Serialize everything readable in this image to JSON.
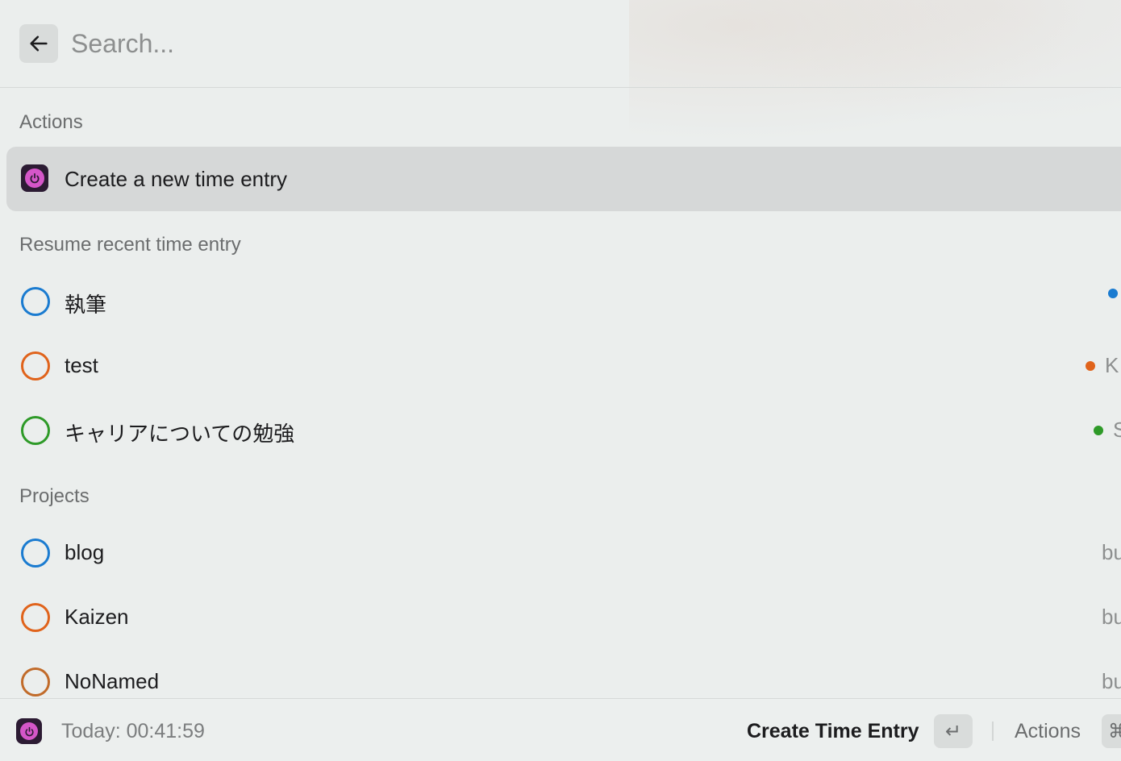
{
  "search": {
    "placeholder": "Search..."
  },
  "sections": {
    "actions_title": "Actions",
    "resume_title": "Resume recent time entry",
    "projects_title": "Projects"
  },
  "actions": [
    {
      "label": "Create a new time entry",
      "icon": "toggl-app-icon"
    }
  ],
  "recent_entries": [
    {
      "label": "執筆",
      "color": "#1a7bd0",
      "accessory": ""
    },
    {
      "label": "test",
      "color": "#e0631b",
      "accessory": "K"
    },
    {
      "label": "キャリアについての勉強",
      "color": "#2e9a28",
      "accessory": "S"
    }
  ],
  "projects": [
    {
      "label": "blog",
      "color": "#1a7bd0",
      "accessory": "bu"
    },
    {
      "label": "Kaizen",
      "color": "#e0631b",
      "accessory": "bu"
    },
    {
      "label": "NoNamed",
      "color": "#c16b2a",
      "accessory": "bu"
    }
  ],
  "footer": {
    "status": "Today: 00:41:59",
    "primary_action": "Create Time Entry",
    "primary_key": "↵",
    "actions_label": "Actions",
    "actions_key": "⌘"
  },
  "colors": {
    "accent_pink": "#d556c9",
    "icon_bg": "#2c1b33",
    "selected_row": "#d6d8d8"
  }
}
